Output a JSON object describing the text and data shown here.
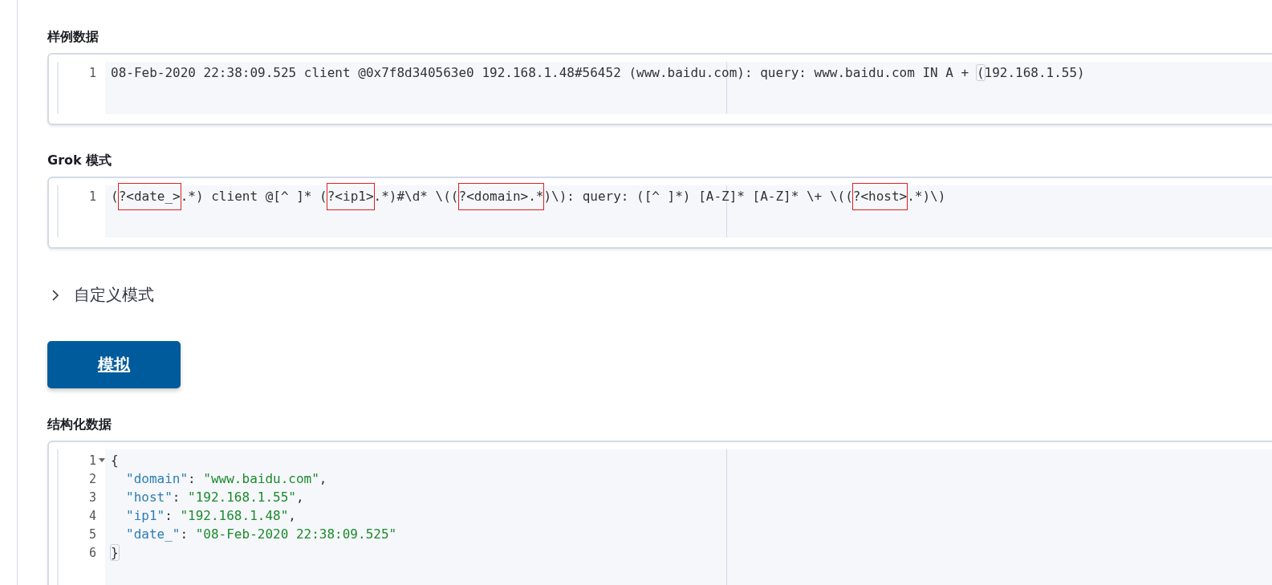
{
  "sample_data": {
    "title": "样例数据",
    "lines": [
      {
        "number": "1",
        "foldable": false,
        "indented": false,
        "segments": [
          {
            "kind": "text",
            "text": "08-Feb-2020 22:38:09.525 client @0x7f8d340563e0 192.168.1.48#56452 (www.baidu.com): query: www.baidu.com IN A + "
          },
          {
            "kind": "bracket",
            "text": "("
          },
          {
            "kind": "text",
            "text": "192.168.1.55)"
          }
        ]
      }
    ]
  },
  "grok_pattern": {
    "title": "Grok 模式",
    "lines": [
      {
        "number": "1",
        "foldable": false,
        "indented": false,
        "segments": [
          {
            "kind": "text",
            "text": "("
          },
          {
            "kind": "group",
            "text": "?<date_>"
          },
          {
            "kind": "text",
            "text": ".*) client @[^ ]* ("
          },
          {
            "kind": "group",
            "text": "?<ip1>"
          },
          {
            "kind": "text",
            "text": ".*)#\\d* \\(("
          },
          {
            "kind": "group",
            "text": "?<domain>.*"
          },
          {
            "kind": "text",
            "text": ")\\): query: ([^ ]*) [A-Z]* [A-Z]* \\+ \\(("
          },
          {
            "kind": "group",
            "text": "?<host>"
          },
          {
            "kind": "text",
            "text": ".*)\\)"
          }
        ]
      }
    ]
  },
  "custom_patterns": {
    "label": "自定义模式",
    "expanded": false
  },
  "simulate_button": {
    "label": "模拟"
  },
  "structured_data": {
    "title": "结构化数据",
    "lines": [
      {
        "number": "1",
        "foldable": true,
        "indented": false,
        "segments": [
          {
            "kind": "text",
            "text": "{"
          }
        ]
      },
      {
        "number": "2",
        "foldable": false,
        "indented": true,
        "segments": [
          {
            "kind": "key",
            "text": "\"domain\""
          },
          {
            "kind": "text",
            "text": ": "
          },
          {
            "kind": "string",
            "text": "\"www.baidu.com\""
          },
          {
            "kind": "text",
            "text": ","
          }
        ]
      },
      {
        "number": "3",
        "foldable": false,
        "indented": true,
        "segments": [
          {
            "kind": "key",
            "text": "\"host\""
          },
          {
            "kind": "text",
            "text": ": "
          },
          {
            "kind": "string",
            "text": "\"192.168.1.55\""
          },
          {
            "kind": "text",
            "text": ","
          }
        ]
      },
      {
        "number": "4",
        "foldable": false,
        "indented": true,
        "segments": [
          {
            "kind": "key",
            "text": "\"ip1\""
          },
          {
            "kind": "text",
            "text": ": "
          },
          {
            "kind": "string",
            "text": "\"192.168.1.48\""
          },
          {
            "kind": "text",
            "text": ","
          }
        ]
      },
      {
        "number": "5",
        "foldable": false,
        "indented": true,
        "segments": [
          {
            "kind": "key",
            "text": "\"date_\""
          },
          {
            "kind": "text",
            "text": ": "
          },
          {
            "kind": "string",
            "text": "\"08-Feb-2020 22:38:09.525\""
          }
        ]
      },
      {
        "number": "6",
        "foldable": false,
        "indented": false,
        "segments": [
          {
            "kind": "bracket",
            "text": "}"
          }
        ]
      }
    ]
  }
}
